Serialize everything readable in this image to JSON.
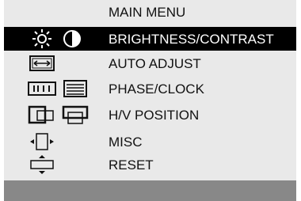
{
  "menu": {
    "title": "MAIN MENU",
    "selected_index": 0,
    "items": [
      {
        "label": "BRIGHTNESS/CONTRAST",
        "icons": [
          "brightness-icon",
          "contrast-icon"
        ]
      },
      {
        "label": "AUTO ADJUST",
        "icons": [
          "auto-adjust-icon"
        ]
      },
      {
        "label": "PHASE/CLOCK",
        "icons": [
          "phase-icon",
          "clock-icon"
        ]
      },
      {
        "label": "H/V POSITION",
        "icons": [
          "h-position-icon",
          "v-position-icon"
        ]
      },
      {
        "label": "MISC",
        "icons": [
          "misc-icon"
        ]
      },
      {
        "label": "RESET",
        "icons": [
          "reset-icon"
        ]
      }
    ]
  },
  "colors": {
    "panel_bg": "#e9e9e9",
    "selected_bg": "#000000",
    "footer_bg": "#888888"
  }
}
